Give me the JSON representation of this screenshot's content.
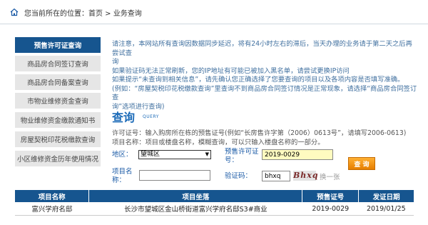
{
  "breadcrumb": {
    "text": "您当前所在的位置：首页 > 业务查询"
  },
  "sidebar": {
    "items": [
      {
        "label": "预售许可证查询",
        "active": true
      },
      {
        "label": "商品房合同签订查询",
        "active": false
      },
      {
        "label": "商品房合同备案查询",
        "active": false
      },
      {
        "label": "市物业维修资金查询",
        "active": false
      },
      {
        "label": "物业维修资金缴款通知书",
        "active": false
      },
      {
        "label": "房屋契税印花税缴款查询",
        "active": false
      },
      {
        "label": "小区维修资金历年使用情况",
        "active": false
      }
    ]
  },
  "notice": {
    "lines": [
      "请注意，本网站所有查询因数据同步延迟，将有24小时左右的滞后，当天办理的业务请于第二天之后再尝试查",
      "询",
      "如果验证码无法正常刷新，您的IP地址有可能已被加入黑名单，请尝试更换IP访问",
      "如果提示“未查询到相关信息”，请先确认您正确选择了您要查询的项目以及各项内容是否填写准确。",
      "(例如：“房屋契税印花税缴款查询”里查询不到商品房合同签订情况是正常现象，请选择“商品房合同签订查",
      "询”选项进行查询)"
    ]
  },
  "query": {
    "title": "查询",
    "subtitle": "QUERY",
    "hint1": "许可证号：输入购房所在栋的预售证号(例如“长房售许字第（2006）0613号”，请填写2006-0613)",
    "hint2": "项目名称：项目或楼盘名称，模糊查询，可以只输入楼盘名称的一部分。",
    "district_label": "地区：",
    "district_value": "望城区",
    "permit_label_1": "预售许可证",
    "permit_label_2": "号：",
    "permit_value": "2019-0029",
    "project_label_1": "项目名",
    "project_label_2": "称：",
    "project_value": "",
    "captcha_label": "验证码：",
    "captcha_value": "bhxq",
    "captcha_image_text": "Bhxq",
    "refresh_label": "换一张",
    "submit_label": "查 询"
  },
  "results": {
    "headers": [
      "项目名称",
      "项目坐落",
      "预售证号",
      "发证日期"
    ],
    "rows": [
      [
        "富兴学府名邸",
        "长沙市望城区金山桥街道富兴学府名邸S3#商业",
        "2019-0029",
        "2019/01/25"
      ]
    ]
  },
  "colors": {
    "accent": "#16558f",
    "link_blue": "#1c6bb8",
    "button_orange": "#f08c00",
    "input_highlight": "#fffbc0"
  }
}
